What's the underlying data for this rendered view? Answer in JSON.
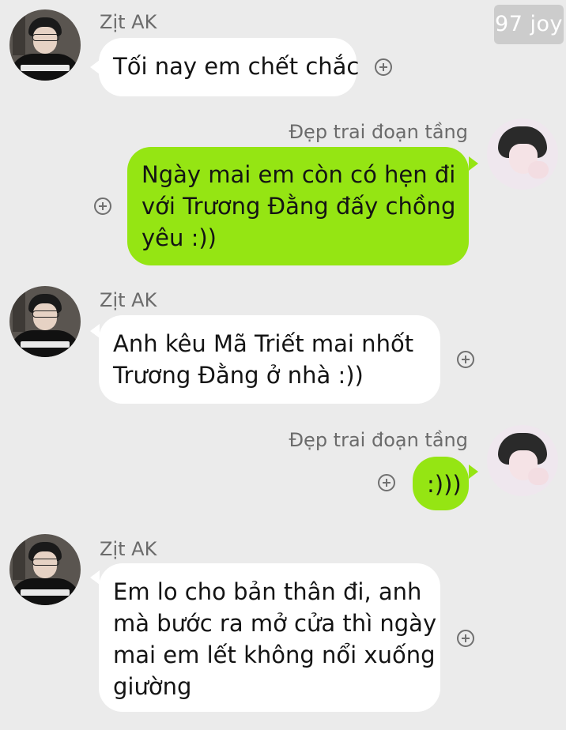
{
  "watermark": "97 joy",
  "contacts": {
    "left_name": "Zịt AK",
    "right_name": "Đẹp trai đoạn tầng"
  },
  "messages": [
    {
      "side": "left",
      "sender": "Zịt AK",
      "lines": [
        "Tối nay em chết chắc"
      ]
    },
    {
      "side": "right",
      "sender": "Đẹp trai đoạn tầng",
      "lines": [
        "Ngày mai em còn có hẹn đi",
        "với Trương Đằng đấy chồng",
        "yêu :))"
      ]
    },
    {
      "side": "left",
      "sender": "Zịt AK",
      "lines": [
        "Anh kêu Mã Triết mai nhốt",
        "Trương Đằng ở nhà :))"
      ]
    },
    {
      "side": "right",
      "sender": "Đẹp trai đoạn tầng",
      "lines": [
        ":)))"
      ]
    },
    {
      "side": "left",
      "sender": "Zịt AK",
      "lines": [
        "Em lo cho bản thân đi, anh",
        "mà bước ra mở cửa thì ngày",
        "mai em lết không nổi xuống",
        "giường"
      ]
    }
  ],
  "icons": {
    "add": "plus-circle-icon",
    "avatar_left": "avatar",
    "avatar_right": "avatar"
  },
  "colors": {
    "background": "#ebebeb",
    "sent_bubble": "#95e513",
    "received_bubble": "#ffffff"
  }
}
